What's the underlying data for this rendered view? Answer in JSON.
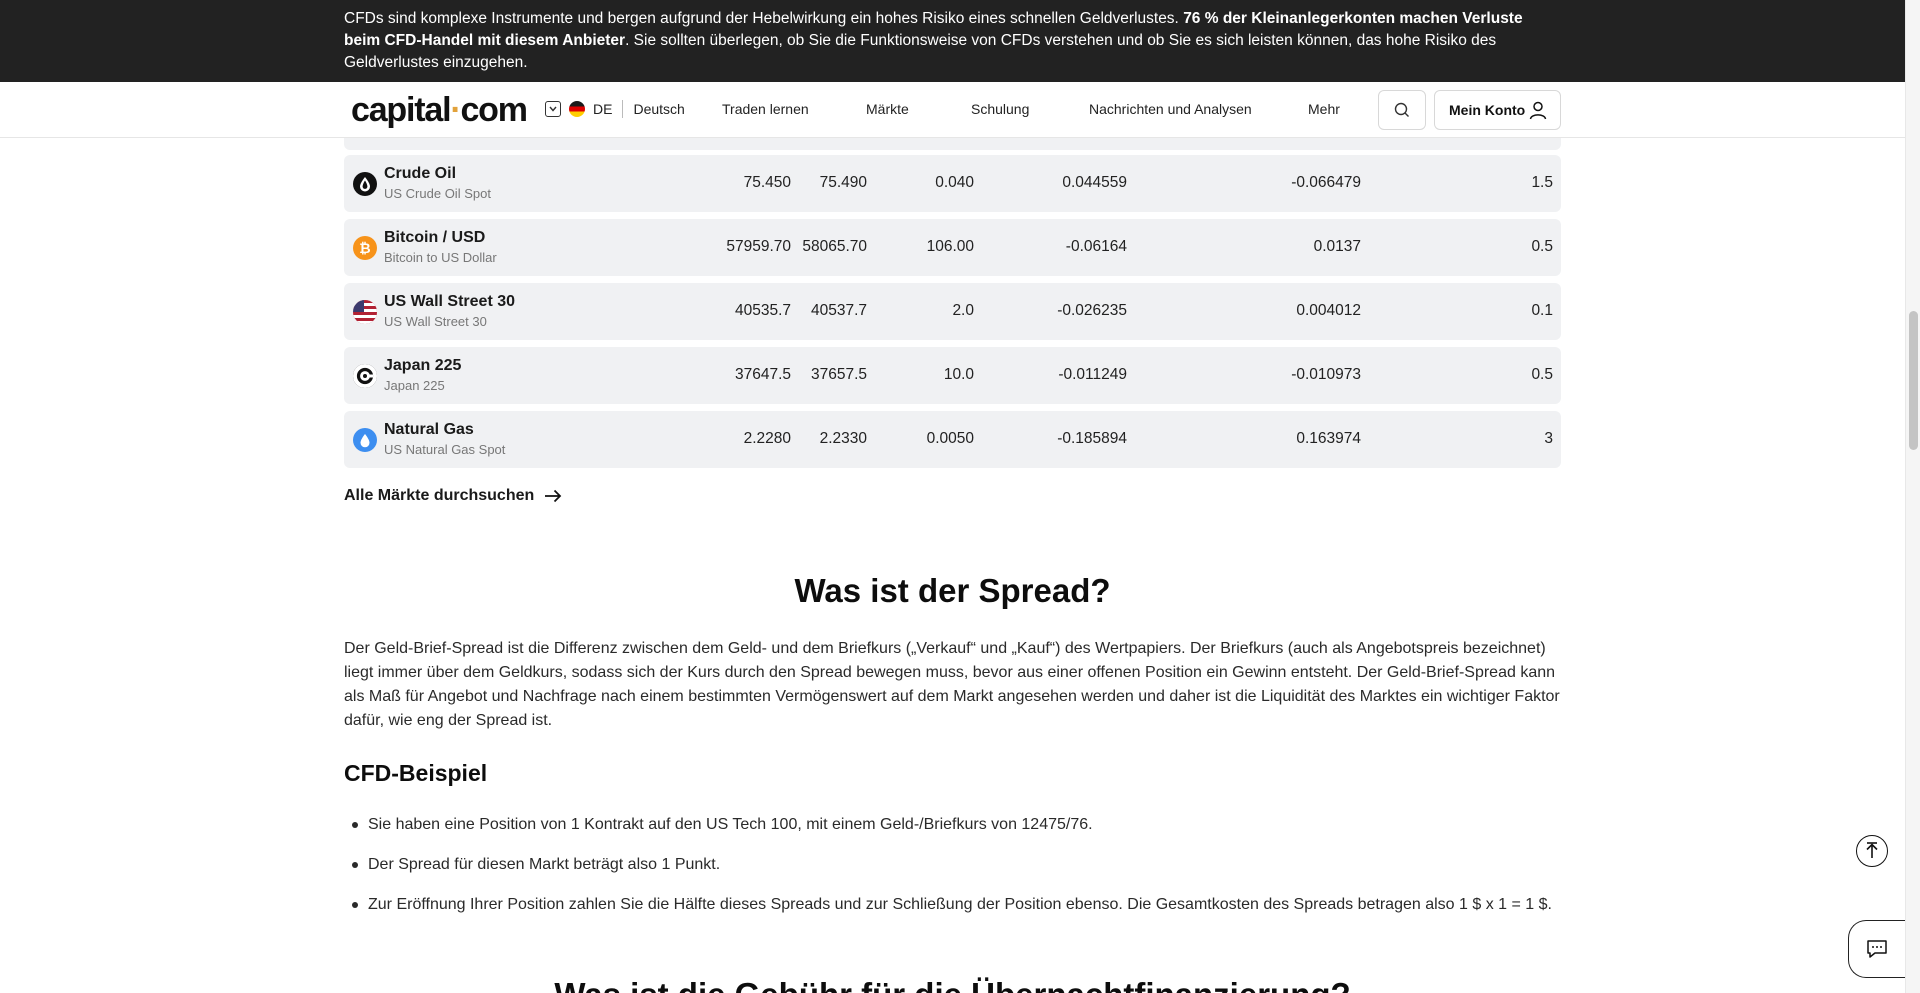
{
  "banner": {
    "text_start": "CFDs sind komplexe Instrumente und bergen aufgrund der Hebelwirkung ein hohes Risiko eines schnellen Geldverlustes. ",
    "text_bold": "76 % der Kleinanlegerkonten machen Verluste beim CFD-Handel mit diesem Anbieter",
    "text_end": ". Sie sollten überlegen, ob Sie die Funktionsweise von CFDs verstehen und ob Sie es sich leisten können, das hohe Risiko des Geldverlustes einzugehen."
  },
  "header": {
    "logo_main": "capital",
    "logo_dot": "·",
    "logo_tld": "com",
    "lang_code": "DE",
    "lang_name": "Deutsch",
    "nav": [
      "Traden lernen",
      "Märkte",
      "Schulung",
      "Nachrichten und Analysen",
      "Mehr"
    ],
    "account_label": "Mein Konto"
  },
  "markets": [
    {
      "name": "Crude Oil",
      "desc": "US Crude Oil Spot",
      "icon": "oil-drop-icon",
      "icon_color": "#111111",
      "sell": "75.450",
      "buy": "75.490",
      "spread": "0.040",
      "overnight_long": "0.044559",
      "overnight_short": "-0.066479",
      "margin": "1.5"
    },
    {
      "name": "Bitcoin / USD",
      "desc": "Bitcoin to US Dollar",
      "icon": "bitcoin-icon",
      "icon_color": "#f7931a",
      "sell": "57959.70",
      "buy": "58065.70",
      "spread": "106.00",
      "overnight_long": "-0.06164",
      "overnight_short": "0.0137",
      "margin": "0.5"
    },
    {
      "name": "US Wall Street 30",
      "desc": "US Wall Street 30",
      "icon": "us-flag-icon",
      "icon_color": "#b22234",
      "sell": "40535.7",
      "buy": "40537.7",
      "spread": "2.0",
      "overnight_long": "-0.026235",
      "overnight_short": "0.004012",
      "margin": "0.1"
    },
    {
      "name": "Japan 225",
      "desc": "Japan 225",
      "icon": "japan-index-icon",
      "icon_color": "#111111",
      "sell": "37647.5",
      "buy": "37657.5",
      "spread": "10.0",
      "overnight_long": "-0.011249",
      "overnight_short": "-0.010973",
      "margin": "0.5"
    },
    {
      "name": "Natural Gas",
      "desc": "US Natural Gas Spot",
      "icon": "gas-drop-icon",
      "icon_color": "#3d8ef0",
      "sell": "2.2280",
      "buy": "2.2330",
      "spread": "0.0050",
      "overnight_long": "-0.185894",
      "overnight_short": "0.163974",
      "margin": "3"
    }
  ],
  "all_markets_link": "Alle Märkte durchsuchen",
  "content": {
    "heading": "Was ist der Spread?",
    "paragraph": "Der Geld-Brief-Spread ist die Differenz zwischen dem Geld- und dem Briefkurs („Verkauf“ und „Kauf“) des Wertpapiers. Der Briefkurs (auch als Angebotspreis bezeichnet) liegt immer über dem Geldkurs, sodass sich der Kurs durch den Spread bewegen muss, bevor aus einer offenen Position ein Gewinn entsteht. Der Geld-Brief-Spread kann als Maß für Angebot und Nachfrage nach einem bestimmten Vermögenswert auf dem Markt angesehen werden und daher ist die Liquidität des Marktes ein wichtiger Faktor dafür, wie eng der Spread ist.",
    "subheading": "CFD-Beispiel",
    "bullets": [
      "Sie haben eine Position von 1 Kontrakt auf den US Tech 100, mit einem Geld-/Briefkurs von 12475/76.",
      "Der Spread für diesen Markt beträgt also 1 Punkt.",
      "Zur Eröffnung Ihrer Position zahlen Sie die Hälfte dieses Spreads und zur Schließung der Position ebenso. Die Gesamtkosten des Spreads betragen also 1 $ x 1 = 1 $."
    ],
    "next_heading": "Was ist die Gebühr für die Übernachtfinanzierung?"
  }
}
